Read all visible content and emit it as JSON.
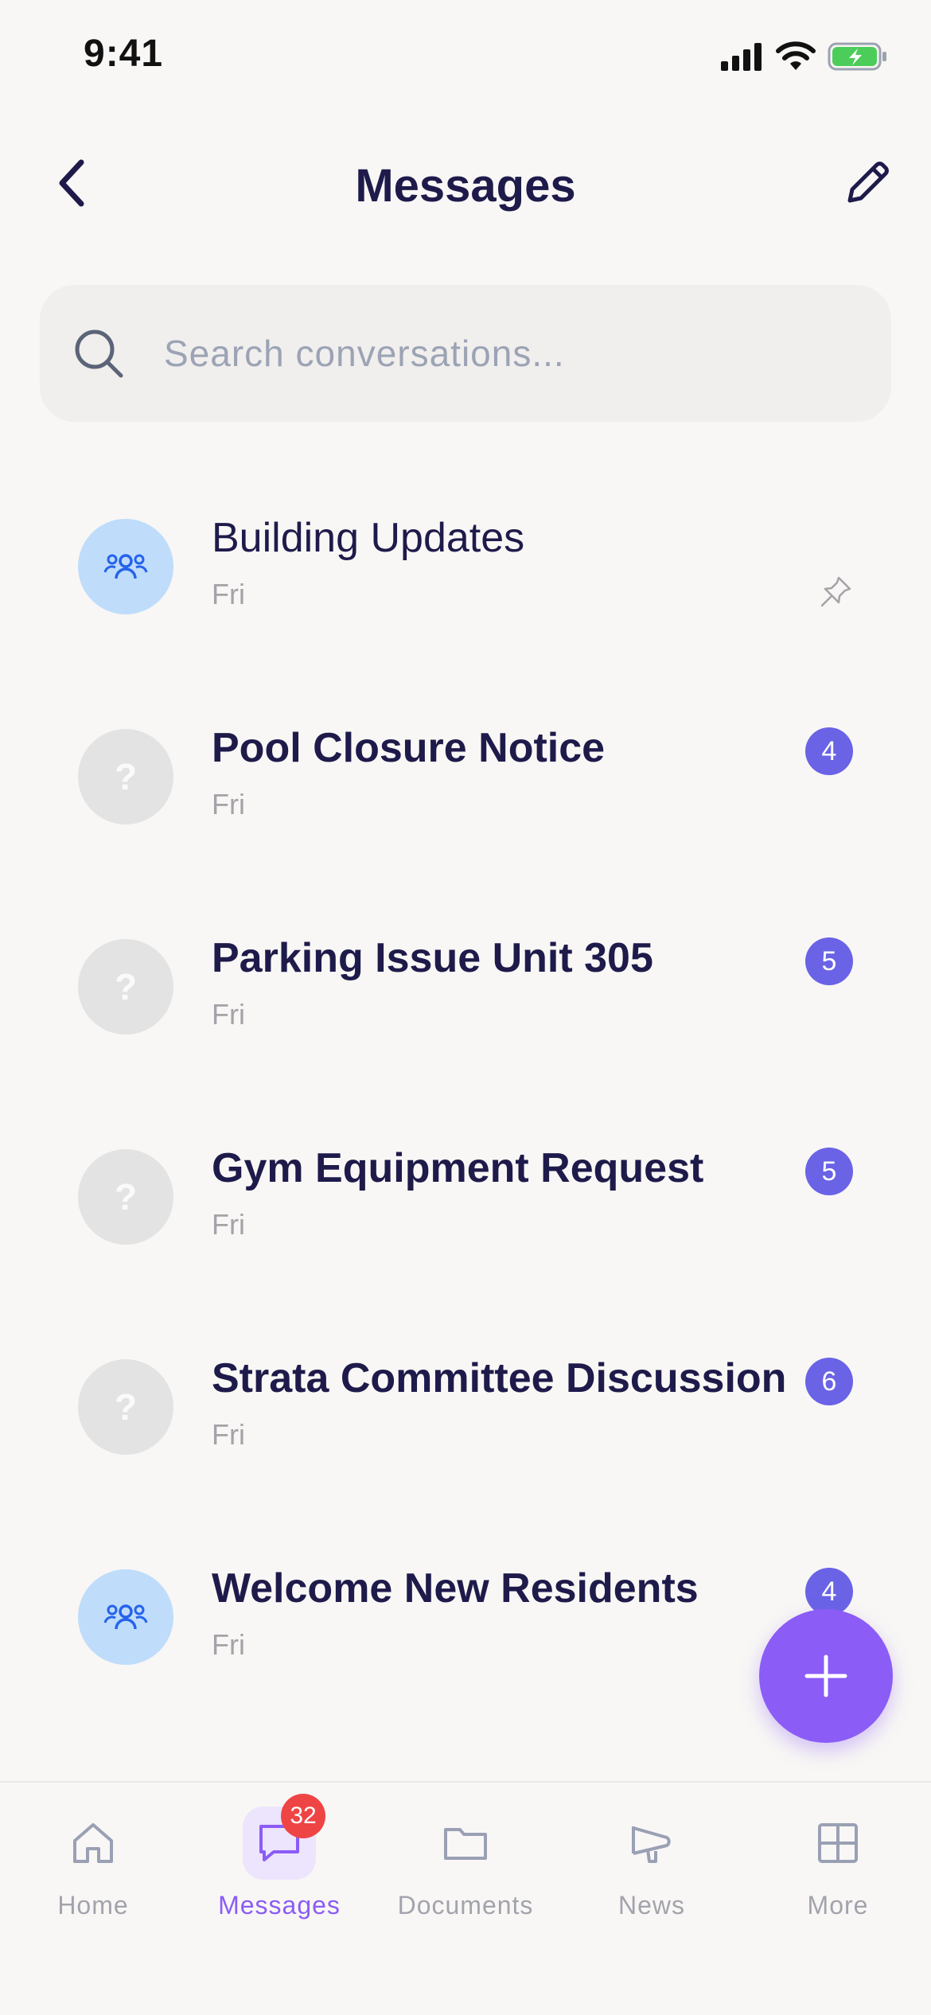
{
  "status_bar": {
    "time": "9:41"
  },
  "header": {
    "title": "Messages"
  },
  "search": {
    "placeholder": "Search conversations...",
    "value": ""
  },
  "conversations": [
    {
      "title": "Building Updates",
      "subtitle": "Fri",
      "avatar": "group-icon",
      "unread": null,
      "pinned": true
    },
    {
      "title": "Pool Closure Notice",
      "subtitle": "Fri",
      "avatar": "?",
      "unread": "4",
      "pinned": false
    },
    {
      "title": "Parking Issue Unit 305",
      "subtitle": "Fri",
      "avatar": "?",
      "unread": "5",
      "pinned": false
    },
    {
      "title": "Gym Equipment Request",
      "subtitle": "Fri",
      "avatar": "?",
      "unread": "5",
      "pinned": false
    },
    {
      "title": "Strata Committee Discussion",
      "subtitle": "Fri",
      "avatar": "?",
      "unread": "6",
      "pinned": false
    },
    {
      "title": "Welcome New Residents",
      "subtitle": "Fri",
      "avatar": "group-icon",
      "unread": "4",
      "pinned": false
    }
  ],
  "tabs": [
    {
      "label": "Home",
      "icon": "home-icon",
      "active": false
    },
    {
      "label": "Messages",
      "icon": "chat-icon",
      "active": true,
      "badge": "32"
    },
    {
      "label": "Documents",
      "icon": "folder-icon",
      "active": false
    },
    {
      "label": "News",
      "icon": "megaphone-icon",
      "active": false
    },
    {
      "label": "More",
      "icon": "grid-icon",
      "active": false
    }
  ],
  "colors": {
    "accent": "#8b5cf6",
    "badge": "#6a63e6",
    "tab_badge": "#ef4444",
    "title": "#1e1b4b"
  }
}
